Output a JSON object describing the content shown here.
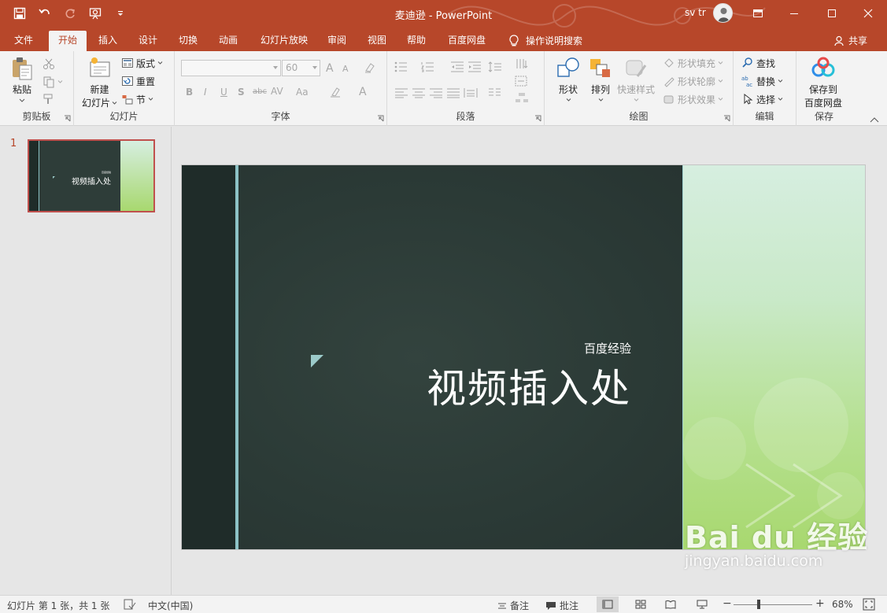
{
  "window": {
    "title": "麦迪逊 - PowerPoint",
    "user": "sv tr"
  },
  "tabs": [
    {
      "label": "文件",
      "active": false
    },
    {
      "label": "开始",
      "active": true
    },
    {
      "label": "插入",
      "active": false
    },
    {
      "label": "设计",
      "active": false
    },
    {
      "label": "切换",
      "active": false
    },
    {
      "label": "动画",
      "active": false
    },
    {
      "label": "幻灯片放映",
      "active": false
    },
    {
      "label": "审阅",
      "active": false
    },
    {
      "label": "视图",
      "active": false
    },
    {
      "label": "帮助",
      "active": false
    },
    {
      "label": "百度网盘",
      "active": false
    }
  ],
  "tell_me": "操作说明搜索",
  "share": "共享",
  "ribbon": {
    "clipboard": {
      "label": "剪贴板",
      "paste": "粘贴"
    },
    "slides": {
      "label": "幻灯片",
      "new_slide_line1": "新建",
      "new_slide_line2": "幻灯片",
      "layout": "版式",
      "reset": "重置",
      "section": "节"
    },
    "font": {
      "label": "字体",
      "size": "60",
      "bold": "B",
      "italic": "I",
      "underline": "U",
      "shadow": "S",
      "strike": "abc",
      "spacing": "AV",
      "case": "Aa",
      "grow": "A",
      "shrink": "A",
      "color": "A"
    },
    "paragraph": {
      "label": "段落"
    },
    "drawing": {
      "label": "绘图",
      "shapes": "形状",
      "arrange": "排列",
      "quick_styles": "快速样式",
      "fill": "形状填充",
      "outline": "形状轮廓",
      "effects": "形状效果"
    },
    "editing": {
      "label": "编辑",
      "find": "查找",
      "replace": "替换",
      "select": "选择"
    },
    "save": {
      "label": "保存",
      "btn_line1": "保存到",
      "btn_line2": "百度网盘"
    }
  },
  "thumbnails": [
    {
      "number": "1",
      "subtitle": "百度经验",
      "title": "视频插入处"
    }
  ],
  "slide": {
    "subtitle": "百度经验",
    "title": "视频插入处"
  },
  "watermark": {
    "brand": "Bai du 经验",
    "url": "jingyan.baidu.com"
  },
  "status": {
    "slide_info": "幻灯片 第 1 张，共 1 张",
    "language": "中文(中国)",
    "notes": "备注",
    "comments": "批注",
    "zoom": "68%"
  },
  "colors": {
    "accent": "#b7472a",
    "slide_dark": "#2b3a36",
    "slide_teal": "#8dc3c6",
    "slide_green": "#b5e08f"
  }
}
